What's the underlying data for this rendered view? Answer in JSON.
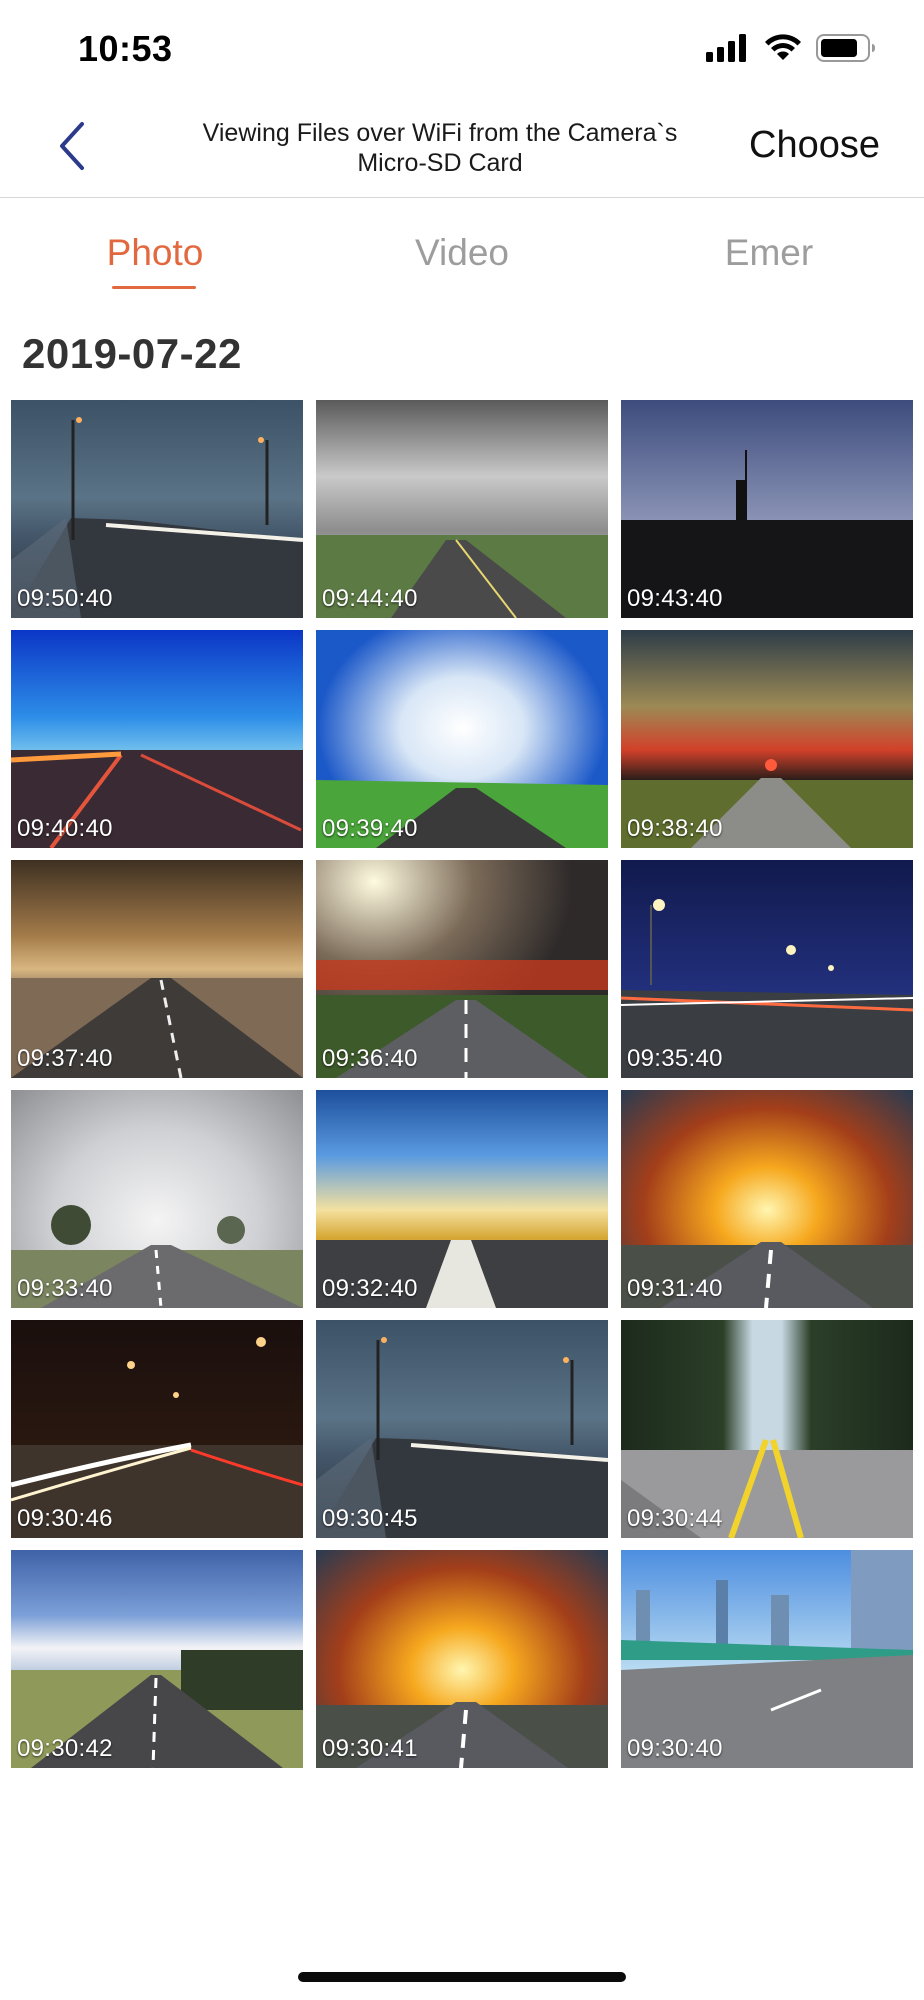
{
  "status_bar": {
    "time": "10:53"
  },
  "nav": {
    "title_line1": "Viewing Files over WiFi from the Camera`s",
    "title_line2": "Micro-SD Card",
    "choose_label": "Choose"
  },
  "tabs": [
    {
      "label": "Photo",
      "active": true
    },
    {
      "label": "Video",
      "active": false
    },
    {
      "label": "Emer",
      "active": false
    }
  ],
  "date_group": "2019-07-22",
  "photos": [
    {
      "time": "09:50:40"
    },
    {
      "time": "09:44:40"
    },
    {
      "time": "09:43:40"
    },
    {
      "time": "09:40:40"
    },
    {
      "time": "09:39:40"
    },
    {
      "time": "09:38:40"
    },
    {
      "time": "09:37:40"
    },
    {
      "time": "09:36:40"
    },
    {
      "time": "09:35:40"
    },
    {
      "time": "09:33:40"
    },
    {
      "time": "09:32:40"
    },
    {
      "time": "09:31:40"
    },
    {
      "time": "09:30:46"
    },
    {
      "time": "09:30:45"
    },
    {
      "time": "09:30:44"
    },
    {
      "time": "09:30:42"
    },
    {
      "time": "09:30:41"
    },
    {
      "time": "09:30:40"
    }
  ],
  "colors": {
    "accent": "#e2683f",
    "back_arrow": "#2c3a8c",
    "inactive_tab": "#9d9d9d"
  }
}
